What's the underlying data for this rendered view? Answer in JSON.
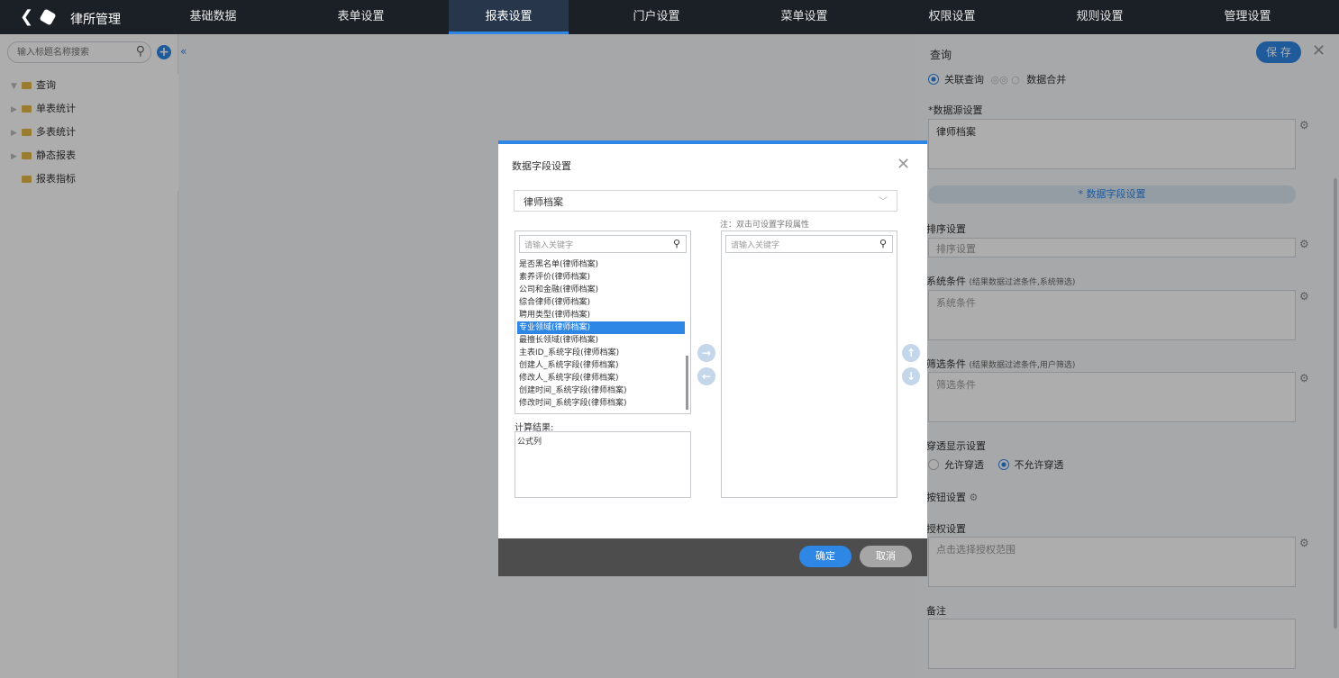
{
  "topbar": {
    "back_icon": "chevron-left-icon",
    "logo_icon": "cube-icon",
    "app_title": "律所管理",
    "tabs": [
      "基础数据",
      "表单设置",
      "报表设置",
      "门户设置",
      "菜单设置",
      "权限设置",
      "规则设置",
      "管理设置"
    ],
    "active_tab": "报表设置"
  },
  "sidebar": {
    "search_placeholder": "输入标题名称搜索",
    "tree": [
      "查询",
      "单表统计",
      "多表统计",
      "静态报表",
      "报表指标"
    ]
  },
  "right_panel": {
    "title": "查询",
    "save_label": "保 存",
    "query_type_options": [
      "关联查询",
      "数据合并"
    ],
    "datasource_label": "*数据源设置",
    "datasource_value": "律师档案",
    "field_settings_link": "* 数据字段设置",
    "sort_label": "排序设置",
    "sort_placeholder": "排序设置",
    "system_condition_label": "系统条件",
    "system_condition_hint": "(结果数据过滤条件,系统筛选)",
    "system_condition_placeholder": "系统条件",
    "filter_condition_label": "筛选条件",
    "filter_condition_hint": "(结果数据过滤条件,用户筛选)",
    "filter_condition_placeholder": "筛选条件",
    "drill_label": "穿透显示设置",
    "drill_options": [
      "允许穿透",
      "不允许穿透"
    ],
    "drill_selected": "不允许穿透",
    "button_settings_label": "按钮设置",
    "auth_label": "授权设置",
    "auth_placeholder": "点击选择授权范围",
    "remark_label": "备注"
  },
  "dialog": {
    "title": "数据字段设置",
    "source_select": "律师档案",
    "note": "注：双击可设置字段属性",
    "left_search_placeholder": "请输入关键字",
    "right_search_placeholder": "请输入关键字",
    "fields": [
      "是否黑名单(律师档案)",
      "素养评价(律师档案)",
      "公司和金融(律师档案)",
      "综合律师(律师档案)",
      "聘用类型(律师档案)",
      "专业领域(律师档案)",
      "最擅长领域(律师档案)",
      "主表ID_系统字段(律师档案)",
      "创建人_系统字段(律师档案)",
      "修改人_系统字段(律师档案)",
      "创建时间_系统字段(律师档案)",
      "修改时间_系统字段(律师档案)"
    ],
    "selected_field": "专业领域(律师档案)",
    "calc_label": "计算结果:",
    "calc_value": "公式列",
    "ok_label": "确定",
    "cancel_label": "取消"
  }
}
